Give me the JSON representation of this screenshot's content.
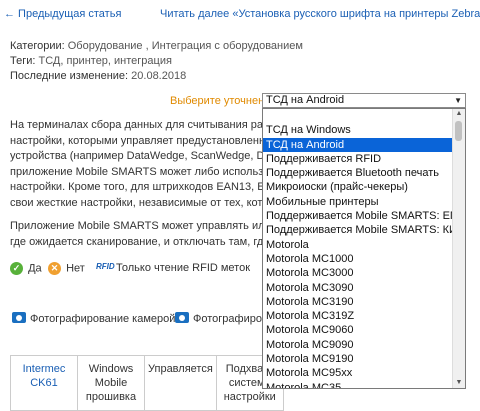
{
  "nav": {
    "prev": "← Предыдущая статья",
    "next": "Читать далее «Установка русского шрифта на принтеры Zebra» →"
  },
  "meta": {
    "categories_label": "Категории:",
    "categories_value": "Оборудование , Интеграция с оборудованием",
    "tags_label": "Теги:",
    "tags_value": "ТСД, принтер, интеграция",
    "changed_label": "Последние изменение:",
    "changed_value": "20.08.2018"
  },
  "selector": {
    "label": "Выберите уточнение:",
    "value": "ТСД на Android",
    "options": [
      "",
      "ТСД на Windows",
      "ТСД на Android",
      "Поддерживается RFID",
      "Поддерживается Bluetooth печать",
      "Микроиоски (прайс-чекеры)",
      "Мобильные принтеры",
      "Поддерживается Mobile SMARTS: ЕГАИС",
      "Поддерживается Mobile SMARTS: КИЗ",
      "Motorola",
      "Motorola MC1000",
      "Motorola MC3000",
      "Motorola MC3090",
      "Motorola MC3190",
      "Motorola MC319Z",
      "Motorola MC9060",
      "Motorola MC9090",
      "Motorola MC9190",
      "Motorola MC95xx",
      "Motorola MC35"
    ]
  },
  "para1": [
    "На терминалах сбора данных для считывания разных к",
    "настройки, которыми управляет предустановленная ш",
    "устройства (например DataWedge, ScanWedge, DemoSc",
    "приложение Mobile SMARTS может либо использоват",
    "настройки.  Кроме того, для штрихкодов EAN13, EAN1",
    "свои жесткие настройки, независимые от тех, которые"
  ],
  "para2": [
    "Приложение Mobile SMARTS может управлять или не у",
    "где ожидается сканирование, и отключать там, где ска"
  ],
  "legend": {
    "yes": "Да",
    "no": "Нет",
    "rfid_badge": "RFID",
    "rfid": "Только чтение RFID меток"
  },
  "camera": {
    "photo": "Фотографирование камерой",
    "photo2": "Фотографирова"
  },
  "table": {
    "cells": [
      [
        "Intermec",
        "CK61"
      ],
      [
        "Windows",
        "Mobile",
        "прошивка"
      ],
      [
        "Управляется"
      ],
      [
        "Подхвать",
        "системн",
        "настройки"
      ]
    ]
  }
}
